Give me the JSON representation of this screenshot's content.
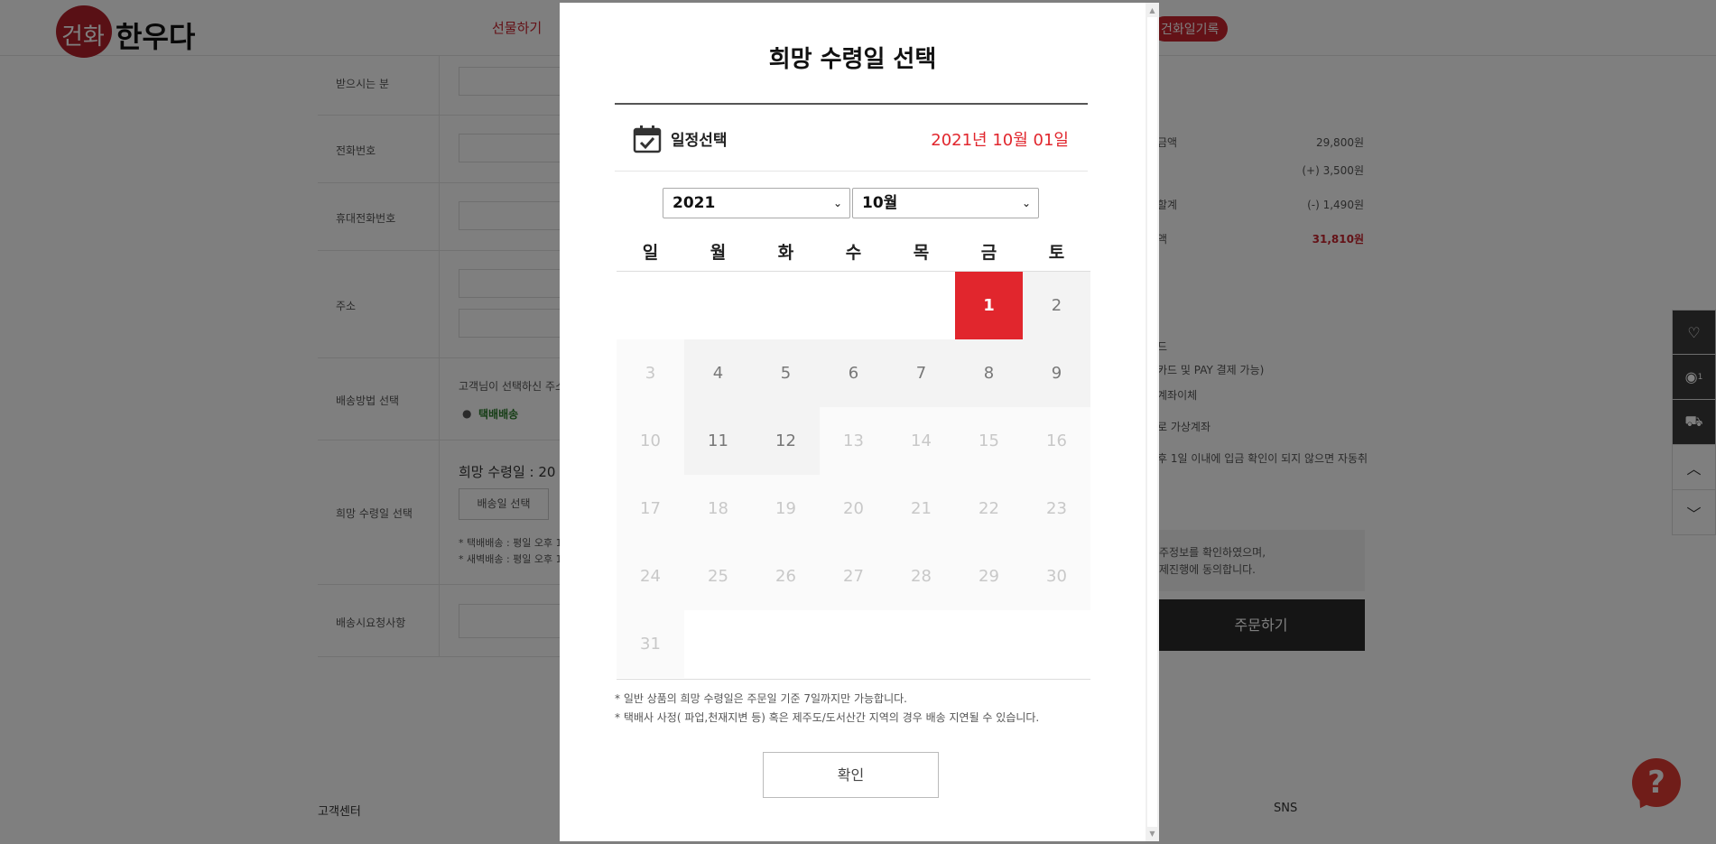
{
  "header": {
    "logo_seal": "건화",
    "logo_text": "한우다",
    "nav_gift": "선물하기",
    "nav_diary": "건화일기록"
  },
  "form": {
    "receiver_label": "받으시는 분",
    "phone_label": "전화번호",
    "mobile_label": "휴대전화번호",
    "address_label": "주소",
    "delivery_method_label": "배송방법 선택",
    "delivery_method_text": "고객님이 선택하신 주소",
    "delivery_option": "택배배송",
    "wish_date_label": "희망 수령일 선택",
    "wish_date_text": "희망 수령일 : 20",
    "select_date_button": "배송일 선택",
    "note_parcel": "* 택배배송 : 평일 오후 1",
    "note_dawn": "* 새벽배송 : 평일 오후 1",
    "request_label": "배송시요청사항"
  },
  "summary": {
    "rows": [
      {
        "label": "금액",
        "value": "29,800원"
      },
      {
        "label": "",
        "value": "(+) 3,500원"
      },
      {
        "label": "할계",
        "value": "(-) 1,490원"
      },
      {
        "label": "액",
        "value": "31,810원"
      }
    ],
    "pay_lines": [
      "드",
      "카드 및 PAY 결제 가능)",
      "계좌이체",
      "로 가상계좌",
      "후 1일 이내에 입금 확인이 되지 않으면 자동취"
    ],
    "agree_lines": [
      "주정보를 확인하였으며,",
      "제진행에 동의합니다."
    ],
    "order_button": "주문하기"
  },
  "footer": {
    "customer_center": "고객센터",
    "sns": "SNS"
  },
  "side_rail": {
    "recent_count": "1"
  },
  "modal": {
    "title": "희망 수령일 선택",
    "schedule_label": "일정선택",
    "selected_date": "2021년 10월 01일",
    "year_value": "2021",
    "month_value": "10월",
    "weekdays": [
      "일",
      "월",
      "화",
      "수",
      "목",
      "금",
      "토"
    ],
    "days": [
      {
        "d": "1",
        "state": "selected"
      },
      {
        "d": "2",
        "state": "ok"
      },
      {
        "d": "3",
        "state": "dis"
      },
      {
        "d": "4",
        "state": "ok"
      },
      {
        "d": "5",
        "state": "ok"
      },
      {
        "d": "6",
        "state": "ok"
      },
      {
        "d": "7",
        "state": "ok"
      },
      {
        "d": "8",
        "state": "ok"
      },
      {
        "d": "9",
        "state": "ok"
      },
      {
        "d": "10",
        "state": "dis"
      },
      {
        "d": "11",
        "state": "ok"
      },
      {
        "d": "12",
        "state": "ok"
      },
      {
        "d": "13",
        "state": "dis"
      },
      {
        "d": "14",
        "state": "dis"
      },
      {
        "d": "15",
        "state": "dis"
      },
      {
        "d": "16",
        "state": "dis"
      },
      {
        "d": "17",
        "state": "dis"
      },
      {
        "d": "18",
        "state": "dis"
      },
      {
        "d": "19",
        "state": "dis"
      },
      {
        "d": "20",
        "state": "dis"
      },
      {
        "d": "21",
        "state": "dis"
      },
      {
        "d": "22",
        "state": "dis"
      },
      {
        "d": "23",
        "state": "dis"
      },
      {
        "d": "24",
        "state": "dis"
      },
      {
        "d": "25",
        "state": "dis"
      },
      {
        "d": "26",
        "state": "dis"
      },
      {
        "d": "27",
        "state": "dis"
      },
      {
        "d": "28",
        "state": "dis"
      },
      {
        "d": "29",
        "state": "dis"
      },
      {
        "d": "30",
        "state": "dis"
      },
      {
        "d": "31",
        "state": "dis"
      }
    ],
    "first_weekday": 5,
    "notes": [
      "* 일반 상품의 희망 수령일은 주문일 기준 7일까지만 가능합니다.",
      "* 택배사 사정( 파업,천재지변 등) 혹은 제주도/도서산간 지역의 경우 배송 지연될 수 있습니다."
    ],
    "confirm_label": "확인",
    "accent_color": "#e1262d"
  }
}
